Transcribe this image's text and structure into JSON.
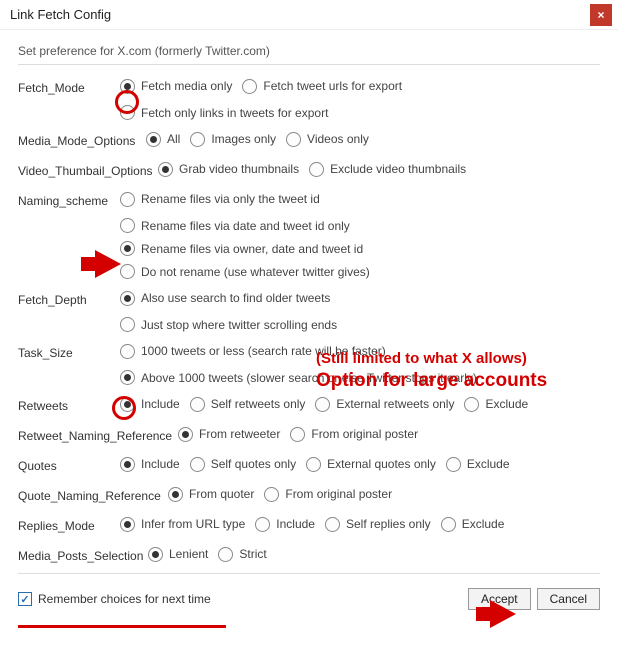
{
  "window": {
    "title": "Link Fetch Config"
  },
  "pref_note": "Set preference for X.com (formerly Twitter.com)",
  "rows": {
    "fetch_mode": {
      "label": "Fetch_Mode",
      "opts": [
        "Fetch media only",
        "Fetch tweet urls for export",
        "Fetch only links in tweets for export"
      ],
      "selected": 0
    },
    "media_mode": {
      "label": "Media_Mode_Options",
      "opts": [
        "All",
        "Images only",
        "Videos only"
      ],
      "selected": 0
    },
    "video_thumb": {
      "label": "Video_Thumbail_Options",
      "opts": [
        "Grab video thumbnails",
        "Exclude video thumbnails"
      ],
      "selected": 0
    },
    "naming": {
      "label": "Naming_scheme",
      "opts": [
        "Rename files via only the tweet id",
        "Rename files via date and tweet id only",
        "Rename files via owner, date and tweet id",
        "Do not rename (use whatever twitter gives)"
      ],
      "selected": 2
    },
    "fetch_depth": {
      "label": "Fetch_Depth",
      "opts": [
        "Also use search to find older tweets",
        "Just stop where twitter scrolling ends"
      ],
      "selected": 0
    },
    "task_size": {
      "label": "Task_Size",
      "opts": [
        "1000 tweets or less (search rate will be faster)",
        "Above 1000 tweets (slower search or else Twitter stops it early)"
      ],
      "selected": 1
    },
    "retweets": {
      "label": "Retweets",
      "opts": [
        "Include",
        "Self retweets only",
        "External retweets only",
        "Exclude"
      ],
      "selected": 0
    },
    "retweet_ref": {
      "label": "Retweet_Naming_Reference",
      "opts": [
        "From retweeter",
        "From original poster"
      ],
      "selected": 0
    },
    "quotes": {
      "label": "Quotes",
      "opts": [
        "Include",
        "Self quotes only",
        "External quotes only",
        "Exclude"
      ],
      "selected": 0
    },
    "quote_ref": {
      "label": "Quote_Naming_Reference",
      "opts": [
        "From quoter",
        "From original poster"
      ],
      "selected": 0
    },
    "replies": {
      "label": "Replies_Mode",
      "opts": [
        "Infer from URL type",
        "Include",
        "Self replies only",
        "Exclude"
      ],
      "selected": 0
    },
    "media_posts": {
      "label": "Media_Posts_Selection",
      "opts": [
        "Lenient",
        "Strict"
      ],
      "selected": 0
    }
  },
  "footer": {
    "remember": "Remember choices for next time",
    "remember_checked": true,
    "accept": "Accept",
    "cancel": "Cancel"
  },
  "annotations": {
    "text1": "(Still limited to what X allows)",
    "text2": "Option for large accounts"
  }
}
